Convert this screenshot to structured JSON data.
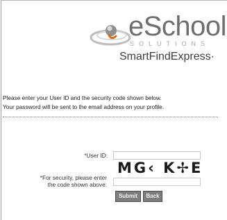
{
  "logo": {
    "wordmark": "eSchool",
    "subtitle": "SOLUTIONS",
    "product": "SmartFindExpress·"
  },
  "intro": {
    "line1": "Please enter your User ID and the security code shown below.",
    "line2": "Your password will be sent to the email address on your profile."
  },
  "form": {
    "user_id_label": "*User ID:",
    "user_id_value": "",
    "security_label_line1": "*For security, please enter",
    "security_label_line2": "the code shown above:",
    "security_code_value": "",
    "captcha_text": "MG‹ K✢E"
  },
  "buttons": {
    "submit": "Submit",
    "back": "Back"
  },
  "colors": {
    "logo_gray": "#6e6e6e",
    "emblem_orange": "#d96b1e",
    "button_gray": "#7e7e7e"
  }
}
